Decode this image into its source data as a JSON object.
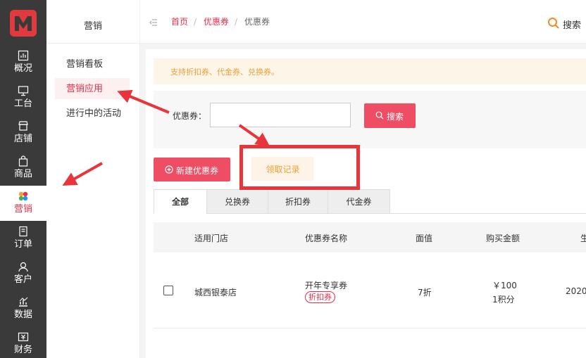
{
  "rail": {
    "items": [
      {
        "label": "概况",
        "icon": "chart-icon"
      },
      {
        "label": "工台",
        "icon": "monitor-icon"
      },
      {
        "label": "店铺",
        "icon": "store-icon"
      },
      {
        "label": "商品",
        "icon": "bag-icon"
      },
      {
        "label": "营销",
        "icon": "petals-icon"
      },
      {
        "label": "订单",
        "icon": "order-icon"
      },
      {
        "label": "客户",
        "icon": "user-icon"
      },
      {
        "label": "数据",
        "icon": "data-icon"
      },
      {
        "label": "财务",
        "icon": "finance-icon"
      }
    ],
    "active_index": 4
  },
  "sidebar": {
    "title": "营销",
    "items": [
      {
        "label": "营销看板"
      },
      {
        "label": "营销应用"
      },
      {
        "label": "进行中的活动"
      }
    ]
  },
  "breadcrumb": {
    "home": "首页",
    "parent": "优惠券",
    "current": "优惠券",
    "sep": "/"
  },
  "topbar": {
    "search_label": "搜索"
  },
  "notice": "支持折扣券、代金券、兑换券。",
  "filter": {
    "label": "优惠券：",
    "input_value": "",
    "search_label": "搜索"
  },
  "actions": {
    "new_label": "新建优惠券",
    "record_label": "领取记录"
  },
  "tabs": [
    {
      "label": "全部"
    },
    {
      "label": "兑换券"
    },
    {
      "label": "折扣券"
    },
    {
      "label": "代金券"
    }
  ],
  "table": {
    "headers": [
      "适用门店",
      "优惠券名称",
      "面值",
      "购买金额",
      "生"
    ],
    "rows": [
      {
        "store": "城西银泰店",
        "name": "开年专享券",
        "tag": "折扣券",
        "value": "7折",
        "price": "￥100",
        "points": "1积分",
        "date": "2020"
      }
    ]
  },
  "colors": {
    "brand": "#e8304a",
    "button": "#ef4d63",
    "notice_text": "#e9a13a",
    "annotation": "#e8353b"
  }
}
